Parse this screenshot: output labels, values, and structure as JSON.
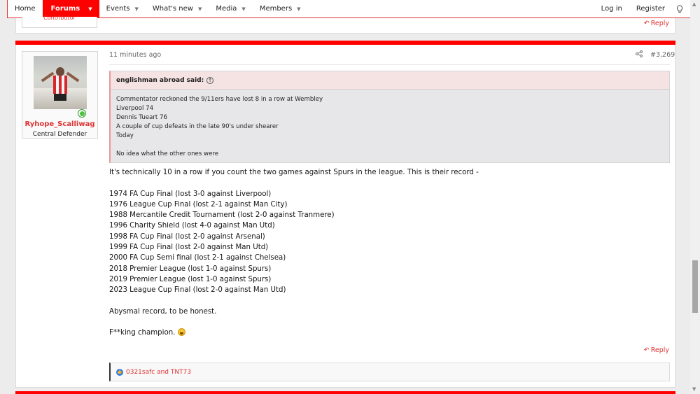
{
  "nav": {
    "items": [
      {
        "label": "Home",
        "has_caret": false
      },
      {
        "label": "Forums",
        "has_caret": true
      },
      {
        "label": "Events",
        "has_caret": true
      },
      {
        "label": "What's new",
        "has_caret": true
      },
      {
        "label": "Media",
        "has_caret": true
      },
      {
        "label": "Members",
        "has_caret": true
      }
    ],
    "right": {
      "login": "Log in",
      "register": "Register",
      "theme_icon": "lightbulb-icon"
    }
  },
  "prev_post": {
    "role": "Contributor",
    "reply": "Reply"
  },
  "post": {
    "time": "11 minutes ago",
    "number": "#3,269",
    "user": {
      "name": "Ryhope_Scalliwag",
      "title": "Central Defender"
    },
    "quote": {
      "author": "englishman abroad said:",
      "lines": [
        "Commentator reckoned the 9/11ers have lost 8 in a row at Wembley",
        "Liverpool 74",
        "Dennis Tueart 76",
        "A couple of cup defeats in the late 90's under shearer",
        "Today",
        "",
        "No idea what the other ones were"
      ]
    },
    "message": {
      "intro": "It's technically 10 in a row if you count the two games against Spurs in the league. This is their record -",
      "record": [
        "1974 FA Cup Final (lost 3-0 against Liverpool)",
        "1976 League Cup Final (lost 2-1 against Man City)",
        "1988 Mercantile Credit Tournament (lost 2-0 against Tranmere)",
        "1996 Charity Shield (lost 4-0 against Man Utd)",
        "1998 FA Cup Final (lost 2-0 against Arsenal)",
        "1999 FA Cup Final (lost 2-0 against Man Utd)",
        "2000 FA Cup Semi final (lost 2-1 against Chelsea)",
        "2018 Premier League (lost 1-0 against Spurs)",
        "2019 Premier League (lost 1-0 against Spurs)",
        "2023 League Cup Final (lost 2-0 against Man Utd)"
      ],
      "verdict": "Abysmal record, to be honest.",
      "closing": "F**king champion."
    },
    "reply": "Reply",
    "reactions": {
      "users": "0321safc and TNT73"
    }
  },
  "colors": {
    "accent": "#ff0000",
    "link": "#e03333"
  }
}
